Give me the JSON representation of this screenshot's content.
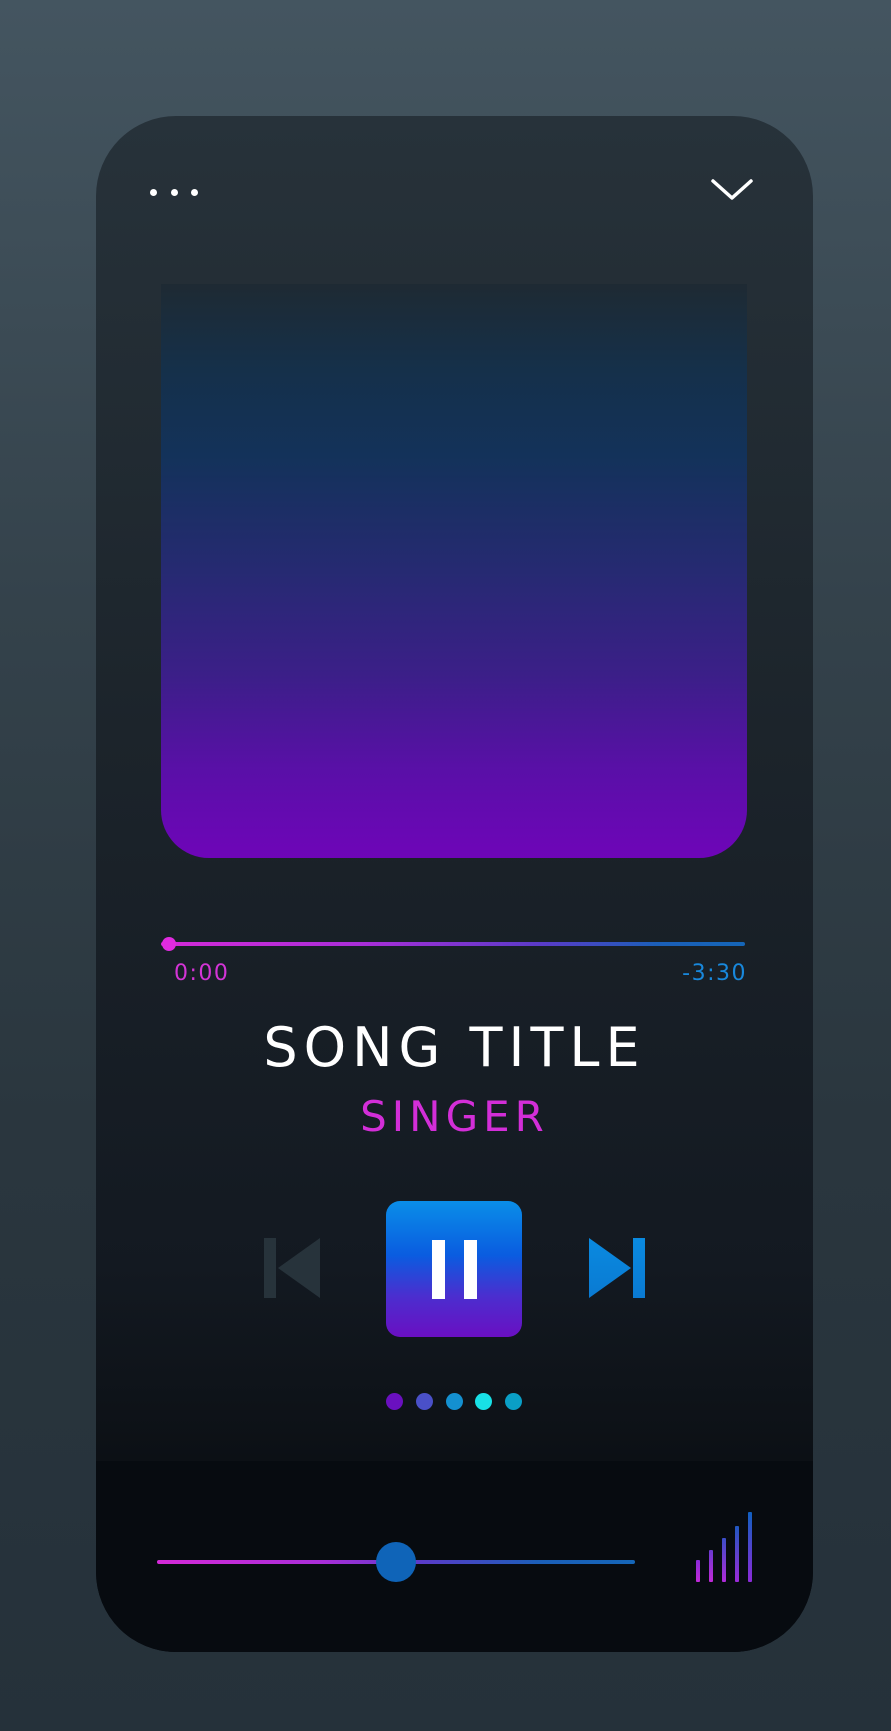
{
  "header": {
    "menu_icon": "more-horizontal-icon",
    "collapse_icon": "chevron-down-icon"
  },
  "artwork": {
    "colors": [
      "#1e2a33",
      "#13325a",
      "#3b1f88",
      "#6e05b8"
    ]
  },
  "playback": {
    "elapsed": "0:00",
    "remaining": "-3:30",
    "progress_fraction": 0.0
  },
  "track": {
    "title": "SONG TITLE",
    "artist": "SINGER"
  },
  "controls": {
    "prev_icon": "skip-previous-icon",
    "pause_icon": "pause-icon",
    "next_icon": "skip-next-icon",
    "state": "playing"
  },
  "pager": {
    "count": 5,
    "colors": [
      "#6a10bf",
      "#4a50c8",
      "#1490d0",
      "#18e0e6",
      "#0a9fc6"
    ]
  },
  "volume": {
    "level_fraction": 0.5,
    "icon": "volume-bars-icon"
  },
  "colors": {
    "accent_pink": "#d32ed8",
    "accent_blue": "#1888dc",
    "inactive": "#27333b"
  }
}
